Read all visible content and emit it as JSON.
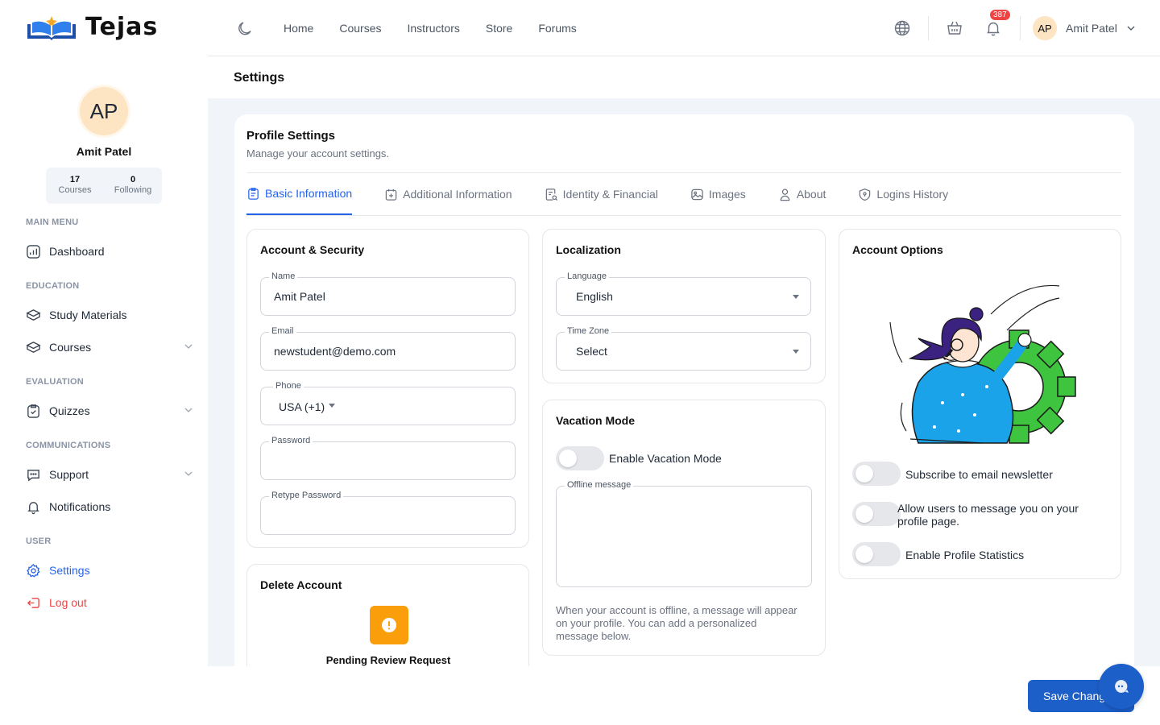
{
  "brand": {
    "name": "Tejas"
  },
  "sidebar": {
    "avatar_initials": "AP",
    "user_name": "Amit Patel",
    "stats": [
      {
        "value": "17",
        "label": "Courses"
      },
      {
        "value": "0",
        "label": "Following"
      }
    ],
    "sections": {
      "main": "MAIN MENU",
      "education": "EDUCATION",
      "evaluation": "EVALUATION",
      "communications": "COMMUNICATIONS",
      "user": "USER"
    },
    "items": {
      "dashboard": "Dashboard",
      "study_materials": "Study Materials",
      "courses": "Courses",
      "quizzes": "Quizzes",
      "support": "Support",
      "notifications": "Notifications",
      "settings": "Settings",
      "logout": "Log out"
    }
  },
  "header": {
    "nav": [
      "Home",
      "Courses",
      "Instructors",
      "Store",
      "Forums"
    ],
    "notification_count": "387",
    "avatar_initials": "AP",
    "user_name": "Amit Patel"
  },
  "page": {
    "title": "Settings",
    "card_title": "Profile Settings",
    "card_subtitle": "Manage your account settings.",
    "tabs": [
      "Basic Information",
      "Additional Information",
      "Identity & Financial",
      "Images",
      "About",
      "Logins History"
    ]
  },
  "account_security": {
    "title": "Account & Security",
    "name_label": "Name",
    "name_value": "Amit Patel",
    "email_label": "Email",
    "email_value": "newstudent@demo.com",
    "phone_label": "Phone",
    "phone_country": "USA (+1)",
    "password_label": "Password",
    "retype_label": "Retype Password"
  },
  "localization": {
    "title": "Localization",
    "language_label": "Language",
    "language_value": "English",
    "timezone_label": "Time Zone",
    "timezone_value": "Select"
  },
  "vacation": {
    "title": "Vacation Mode",
    "toggle_label": "Enable Vacation Mode",
    "offline_label": "Offline message",
    "help": "When your account is offline, a message will appear on your profile. You can add a personalized message below."
  },
  "account_options": {
    "title": "Account Options",
    "newsletter": "Subscribe to email newsletter",
    "allow_messages": "Allow users to message you on your profile page.",
    "profile_stats": "Enable Profile Statistics"
  },
  "delete_account": {
    "title": "Delete Account",
    "status": "Pending Review Request"
  },
  "actions": {
    "save": "Save Changes"
  },
  "colors": {
    "primary": "#2563eb",
    "save": "#1d5fc9",
    "warning": "#fb9e0b",
    "danger": "#ef4444"
  }
}
